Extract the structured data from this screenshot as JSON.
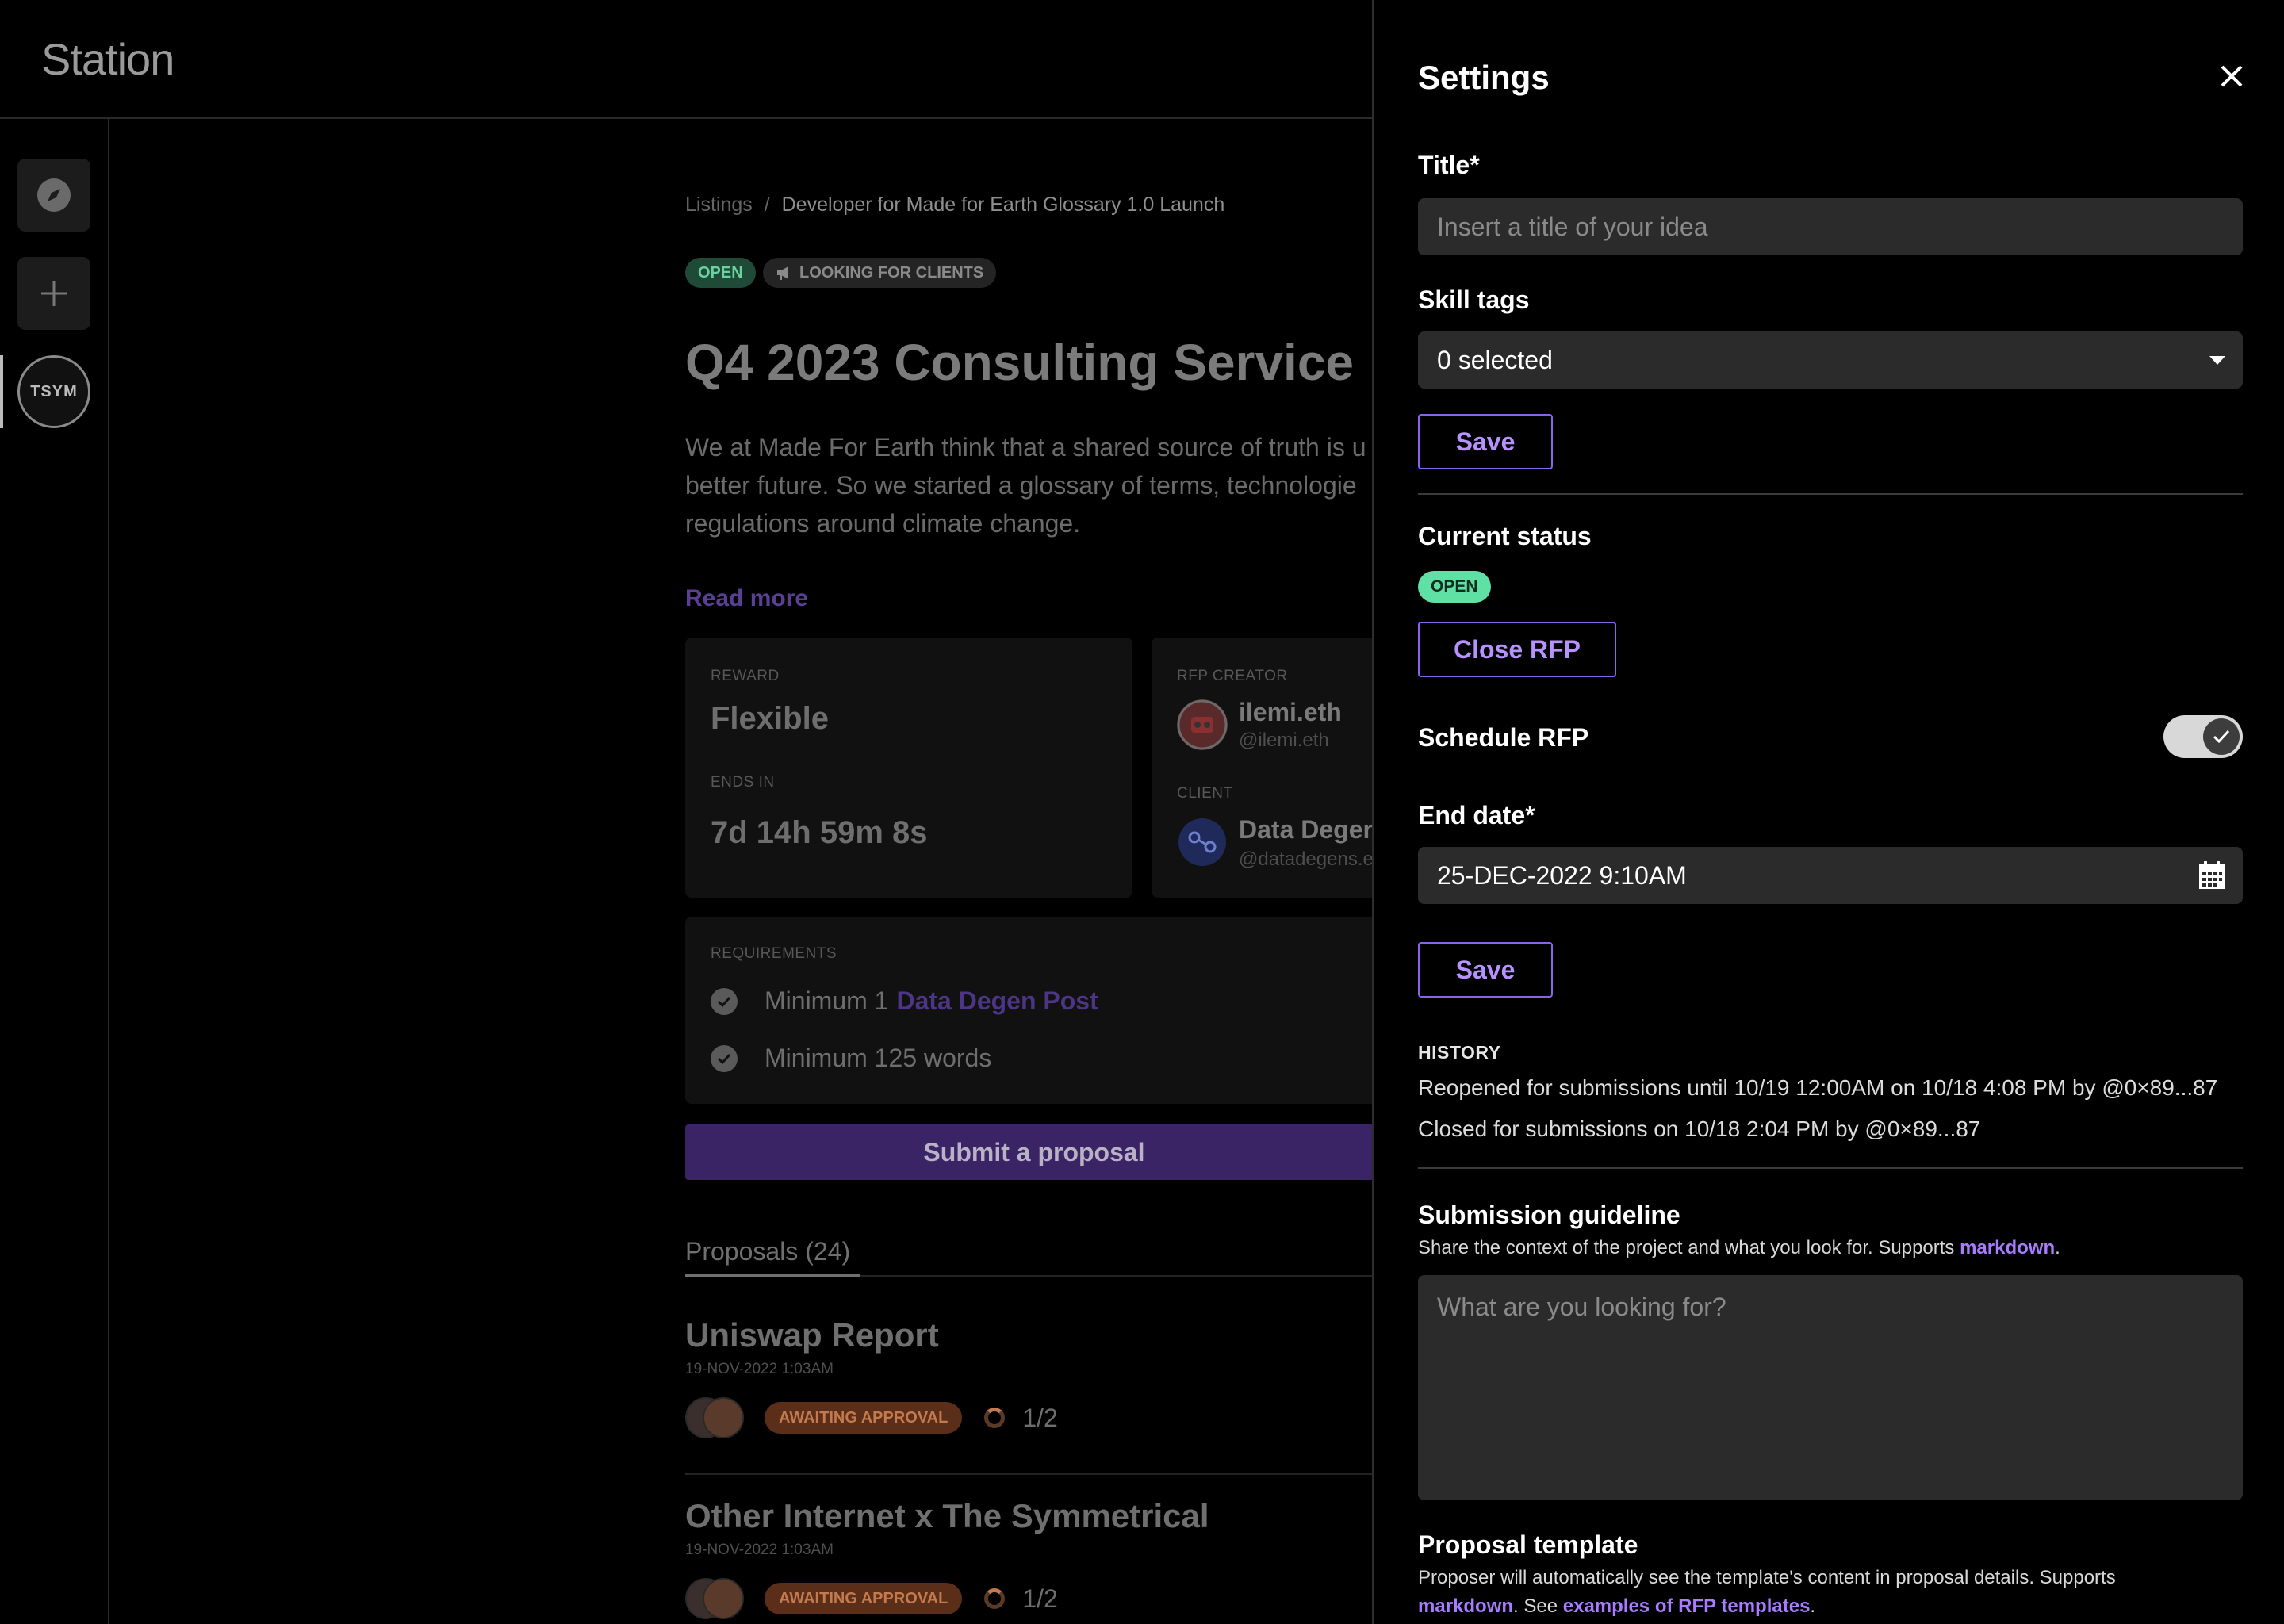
{
  "app": {
    "name": "Station"
  },
  "rail": {
    "avatar_text": "TSYM"
  },
  "breadcrumb": {
    "root": "Listings",
    "separator": "/",
    "current": "Developer for Made for Earth Glossary 1.0 Launch"
  },
  "listing": {
    "status_badge": "OPEN",
    "tag_badge": "LOOKING FOR CLIENTS",
    "title": "Q4 2023 Consulting Service",
    "description_lines": [
      "We at Made For Earth think that a shared source of truth is u",
      "better future. So we started a glossary of terms, technologie",
      "regulations around climate change."
    ],
    "read_more": "Read more",
    "reward_label": "REWARD",
    "reward_value": "Flexible",
    "ends_label": "ENDS IN",
    "ends_value": "7d 14h 59m 8s",
    "creator_label": "RFP CREATOR",
    "creator_name": "ilemi.eth",
    "creator_handle": "@ilemi.eth",
    "client_label": "CLIENT",
    "client_name": "Data Degen",
    "client_handle": "@datadegens.e",
    "requirements_label": "REQUIREMENTS",
    "requirements": [
      {
        "prefix": "Minimum 1",
        "link": "Data Degen Post"
      },
      {
        "prefix": "Minimum 125 words",
        "link": ""
      }
    ],
    "submit_button": "Submit a proposal",
    "proposals_tab": "Proposals (24)",
    "proposals": [
      {
        "title": "Uniswap Report",
        "date": "19-NOV-2022 1:03AM",
        "status": "AWAITING APPROVAL",
        "count": "1/2"
      },
      {
        "title": "Other Internet x The Symmetrical",
        "date": "19-NOV-2022 1:03AM",
        "status": "AWAITING APPROVAL",
        "count": "1/2"
      }
    ]
  },
  "settings": {
    "heading": "Settings",
    "title_label": "Title*",
    "title_placeholder": "Insert a title of your idea",
    "skill_tags_label": "Skill tags",
    "skill_tags_value": "0 selected",
    "save_label": "Save",
    "current_status_label": "Current status",
    "current_status_badge": "OPEN",
    "close_rfp_button": "Close RFP",
    "schedule_label": "Schedule RFP",
    "schedule_enabled": true,
    "end_date_label": "End date*",
    "end_date_value": "25-DEC-2022 9:10AM",
    "history_label": "HISTORY",
    "history": [
      "Reopened for submissions until 10/19 12:00AM on 10/18 4:08 PM by @0×89...87",
      "Closed for submissions on 10/18 2:04 PM by @0×89...87"
    ],
    "guideline_label": "Submission guideline",
    "guideline_help_prefix": "Share the context of the project and what you look for. Supports ",
    "guideline_help_link": "markdown",
    "guideline_help_suffix": ".",
    "guideline_placeholder": "What are you looking for?",
    "template_label": "Proposal template",
    "template_help_line1": "Proposer will automatically see the template's content in proposal details. Supports",
    "template_help_link1": "markdown",
    "template_help_mid": ". See ",
    "template_help_link2": "examples of RFP templates",
    "template_help_end": "."
  },
  "colors": {
    "accent": "#8a63e6",
    "open_green": "#5fe0a5",
    "awaiting": "#c37a4f"
  }
}
